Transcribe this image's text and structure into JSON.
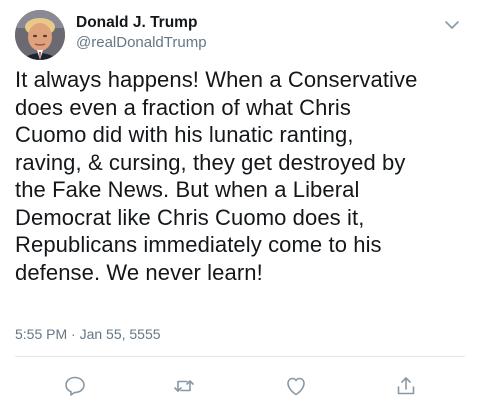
{
  "user": {
    "display_name": "Donald J. Trump",
    "handle": "@realDonaldTrump",
    "avatar_icon": "profile-photo"
  },
  "tweet": {
    "lines": [
      "It always happens! When a Conservative",
      "does even a fraction of what Chris",
      "Cuomo did with his lunatic ranting,",
      "raving, & cursing, they get destroyed by",
      "the Fake News. But when a Liberal",
      "Democrat like Chris Cuomo does it,",
      "Republicans immediately come to his",
      "defense. We never learn!"
    ],
    "timestamp": "5:55 PM · Jan 55, 5555"
  },
  "actions": {
    "reply_icon": "reply-icon",
    "retweet_icon": "retweet-icon",
    "like_icon": "like-icon",
    "share_icon": "share-icon"
  },
  "colors": {
    "text": "#14171a",
    "secondary": "#657786",
    "divider": "#e1e8ed",
    "icon": "#8899a6"
  }
}
